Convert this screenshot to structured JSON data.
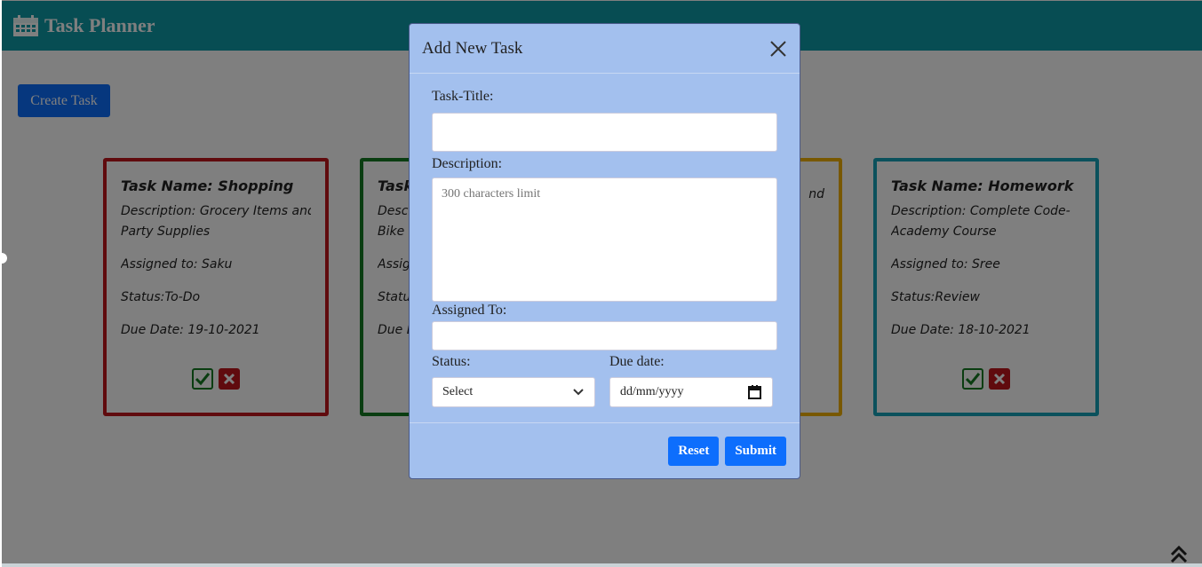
{
  "app": {
    "title": "Task Planner",
    "icon": "calendar-icon"
  },
  "toolbar": {
    "create_label": "Create Task"
  },
  "cards": [
    {
      "title": "Task Name: Shopping",
      "desc1": "Description: Grocery Items and",
      "desc2": "Party Supplies",
      "assigned": "Assigned to: Saku",
      "status": "Status:To-Do",
      "due": "Due Date: 19-10-2021",
      "border": "#c0171c"
    },
    {
      "title": "Task",
      "desc1": "Descr",
      "desc2": "Bike r",
      "assigned": "Assig",
      "status": "Statu",
      "due": "Due D",
      "border": "#157a22"
    },
    {
      "title": "",
      "desc1": "nd",
      "desc2": "",
      "assigned": "",
      "status": "",
      "due": "",
      "border": "#f0b000"
    },
    {
      "title": "Task Name: Homework",
      "desc1": "Description: Complete Code-",
      "desc2": "Academy Course",
      "assigned": "Assigned to: Sree",
      "status": "Status:Review",
      "due": "Due Date: 18-10-2021",
      "border": "#17a2b8"
    }
  ],
  "modal": {
    "title": "Add New Task",
    "title_label": "Task-Title:",
    "desc_label": "Description:",
    "desc_placeholder": "300 characters limit",
    "assigned_label": "Assigned To:",
    "status_label": "Status:",
    "status_value": "Select",
    "due_label": "Due date:",
    "due_placeholder": "dd/mm/yyyy",
    "reset_label": "Reset",
    "submit_label": "Submit"
  },
  "colors": {
    "navbar": "#0e9aa7",
    "modal_bg": "#a3c0ee",
    "primary": "#0d6efd"
  }
}
